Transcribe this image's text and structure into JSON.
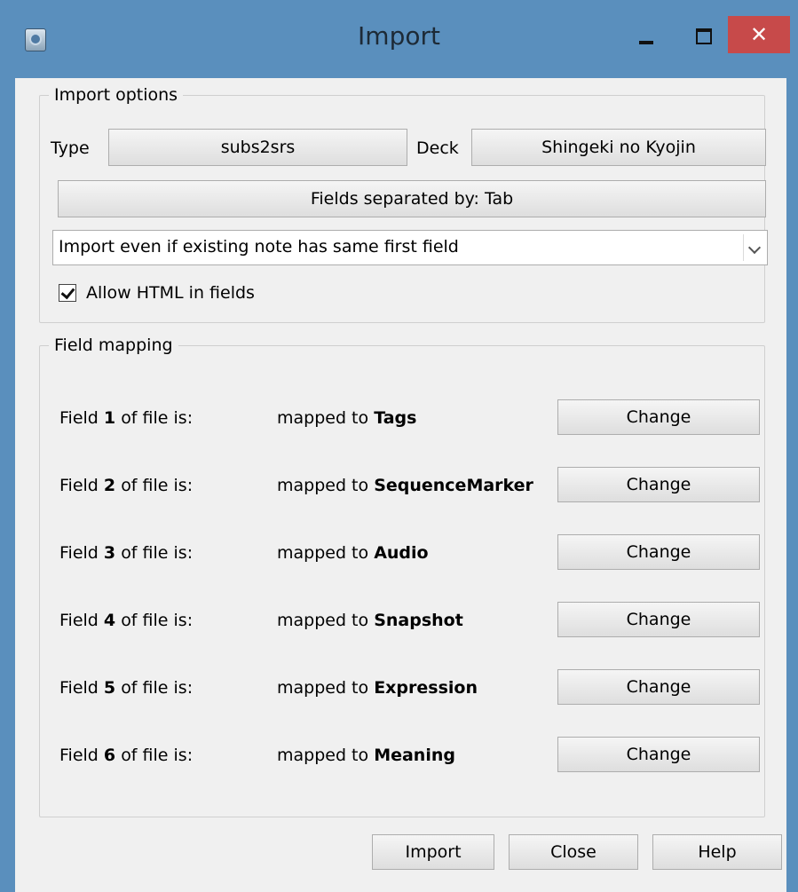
{
  "window": {
    "title": "Import",
    "close_glyph": "✕"
  },
  "import_options": {
    "legend": "Import options",
    "type_label": "Type",
    "type_value": "subs2srs",
    "deck_label": "Deck",
    "deck_value": "Shingeki no Kyojin",
    "separator_button": "Fields separated by: Tab",
    "duplicate_mode": "Import even if existing note has same first field",
    "allow_html_label": "Allow HTML in fields",
    "allow_html_checked": true
  },
  "field_mapping": {
    "legend": "Field mapping",
    "field_prefix": "Field",
    "field_suffix": "of file is:",
    "mapped_prefix": "mapped to",
    "change_label": "Change",
    "rows": [
      {
        "num": "1",
        "target": "Tags"
      },
      {
        "num": "2",
        "target": "SequenceMarker"
      },
      {
        "num": "3",
        "target": "Audio"
      },
      {
        "num": "4",
        "target": "Snapshot"
      },
      {
        "num": "5",
        "target": "Expression"
      },
      {
        "num": "6",
        "target": "Meaning"
      }
    ]
  },
  "footer": {
    "import_label": "Import",
    "close_label": "Close",
    "help_label": "Help"
  }
}
